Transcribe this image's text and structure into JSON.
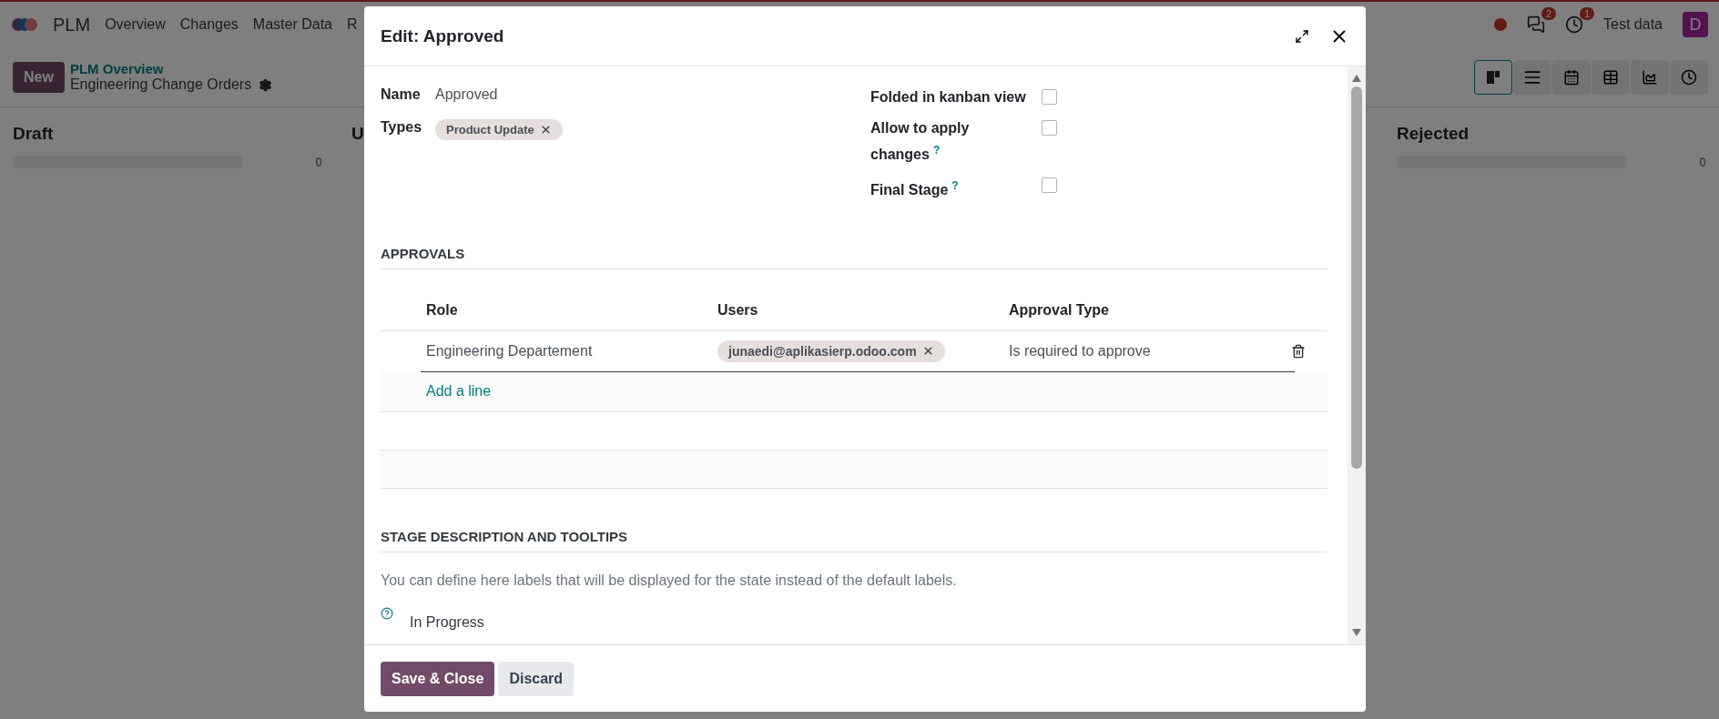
{
  "navbar": {
    "app_name": "PLM",
    "menu": [
      "Overview",
      "Changes",
      "Master Data",
      "R"
    ],
    "messages_count": "2",
    "activities_count": "1",
    "company": "Test data",
    "avatar_initial": "D"
  },
  "control_panel": {
    "new_button": "New",
    "breadcrumb": "PLM Overview",
    "title": "Engineering Change Orders",
    "views": [
      {
        "kind": "kanban",
        "selected": true
      },
      {
        "kind": "list",
        "selected": false
      },
      {
        "kind": "calendar",
        "selected": false
      },
      {
        "kind": "pivot",
        "selected": false
      },
      {
        "kind": "graph",
        "selected": false
      },
      {
        "kind": "activity",
        "selected": false
      }
    ]
  },
  "kanban_columns": [
    {
      "title": "Draft",
      "count": "0",
      "level": 0
    },
    {
      "title": "U"
    },
    {
      "title": "Rejected",
      "count": "0",
      "level": 0
    }
  ],
  "dialog": {
    "title": "Edit: Approved",
    "name": {
      "label": "Name",
      "value": "Approved"
    },
    "types": {
      "label": "Types",
      "tags": [
        "Product Update"
      ]
    },
    "checkboxes": [
      {
        "label": "Folded in kanban view",
        "checked": false
      },
      {
        "label": "Allow to apply changes",
        "help": "?",
        "checked": false
      },
      {
        "label": "Final Stage",
        "help": "?",
        "checked": false
      }
    ],
    "approvals": {
      "title": "APPROVALS",
      "columns": [
        "Role",
        "Users",
        "Approval Type"
      ],
      "rows": [
        {
          "role": "Engineering Departement",
          "users": [
            "junaedi@aplikasierp.odoo.com"
          ],
          "approval_type": "Is required to approve"
        }
      ],
      "add_line": "Add a line"
    },
    "stage_description": {
      "title": "STAGE DESCRIPTION AND TOOLTIPS",
      "text": "You can define here labels that will be displayed for the state instead of the default labels.",
      "items": [
        {
          "label": "In Progress"
        }
      ]
    },
    "buttons": [
      {
        "label": "Save & Close",
        "kind": "primary"
      },
      {
        "label": "Discard",
        "kind": "secondary"
      }
    ]
  }
}
